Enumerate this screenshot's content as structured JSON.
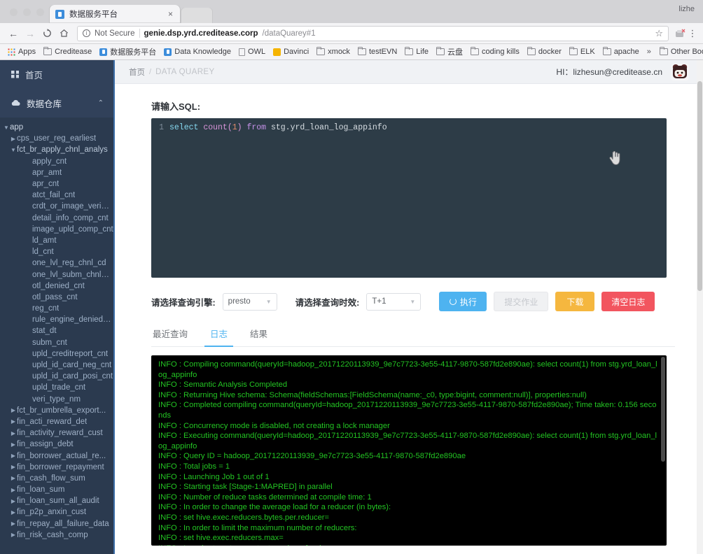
{
  "browser": {
    "tab": {
      "title": "数据服务平台",
      "favicon": "blue-doc-icon",
      "close_label": "×"
    },
    "profile": "lizhe",
    "nav": {
      "back": "←",
      "forward": "→",
      "reload": "C",
      "home": "⌂"
    },
    "omnibox": {
      "security_label": "Not Secure",
      "url_host": "genie.dsp.yrd.creditease.corp",
      "url_path": "/dataQuarey#1",
      "star": "☆",
      "menu": "⋮"
    },
    "bookmarks": [
      {
        "label": "Apps",
        "icon": "apps-grid-icon"
      },
      {
        "label": "Creditease",
        "icon": "folder-icon"
      },
      {
        "label": "数据服务平台",
        "icon": "blue-doc-icon"
      },
      {
        "label": "Data Knowledge",
        "icon": "blue-doc-icon"
      },
      {
        "label": "OWL",
        "icon": "page-icon"
      },
      {
        "label": "Davinci",
        "icon": "yellow-doc-icon"
      },
      {
        "label": "xmock",
        "icon": "folder-icon"
      },
      {
        "label": "testEVN",
        "icon": "folder-icon"
      },
      {
        "label": "Life",
        "icon": "folder-icon"
      },
      {
        "label": "云盘",
        "icon": "folder-icon"
      },
      {
        "label": "coding kills",
        "icon": "folder-icon"
      },
      {
        "label": "docker",
        "icon": "folder-icon"
      },
      {
        "label": "ELK",
        "icon": "folder-icon"
      },
      {
        "label": "apache",
        "icon": "folder-icon"
      }
    ],
    "bookmarks_overflow": "»",
    "other_bookmarks": "Other Bookmarks"
  },
  "sidebar": {
    "home_label": "首页",
    "group_label": "数据仓库",
    "group_caret": "⌃",
    "tree": [
      {
        "level": 0,
        "arrow": "▼",
        "label": "app"
      },
      {
        "level": 1,
        "arrow": "▶",
        "label": "cps_user_reg_earliest"
      },
      {
        "level": 1,
        "arrow": "▼",
        "label": "fct_br_apply_chnl_analys"
      },
      {
        "level": 2,
        "arrow": "",
        "label": "apply_cnt"
      },
      {
        "level": 2,
        "arrow": "",
        "label": "apr_amt"
      },
      {
        "level": 2,
        "arrow": "",
        "label": "apr_cnt"
      },
      {
        "level": 2,
        "arrow": "",
        "label": "atct_fail_cnt"
      },
      {
        "level": 2,
        "arrow": "",
        "label": "crdt_or_image_veri_cnt"
      },
      {
        "level": 2,
        "arrow": "",
        "label": "detail_info_comp_cnt"
      },
      {
        "level": 2,
        "arrow": "",
        "label": "image_upld_comp_cnt"
      },
      {
        "level": 2,
        "arrow": "",
        "label": "ld_amt"
      },
      {
        "level": 2,
        "arrow": "",
        "label": "ld_cnt"
      },
      {
        "level": 2,
        "arrow": "",
        "label": "one_lvl_reg_chnl_cd"
      },
      {
        "level": 2,
        "arrow": "",
        "label": "one_lvl_subm_chnl_cd"
      },
      {
        "level": 2,
        "arrow": "",
        "label": "otl_denied_cnt"
      },
      {
        "level": 2,
        "arrow": "",
        "label": "otl_pass_cnt"
      },
      {
        "level": 2,
        "arrow": "",
        "label": "reg_cnt"
      },
      {
        "level": 2,
        "arrow": "",
        "label": "rule_engine_denied_cnt"
      },
      {
        "level": 2,
        "arrow": "",
        "label": "stat_dt"
      },
      {
        "level": 2,
        "arrow": "",
        "label": "subm_cnt"
      },
      {
        "level": 2,
        "arrow": "",
        "label": "upld_creditreport_cnt"
      },
      {
        "level": 2,
        "arrow": "",
        "label": "upld_id_card_neg_cnt"
      },
      {
        "level": 2,
        "arrow": "",
        "label": "upld_id_card_posi_cnt"
      },
      {
        "level": 2,
        "arrow": "",
        "label": "upld_trade_cnt"
      },
      {
        "level": 2,
        "arrow": "",
        "label": "veri_type_nm"
      },
      {
        "level": 1,
        "arrow": "▶",
        "label": "fct_br_umbrella_export..."
      },
      {
        "level": 1,
        "arrow": "▶",
        "label": "fin_acti_reward_det"
      },
      {
        "level": 1,
        "arrow": "▶",
        "label": "fin_activity_reward_cust"
      },
      {
        "level": 1,
        "arrow": "▶",
        "label": "fin_assign_debt"
      },
      {
        "level": 1,
        "arrow": "▶",
        "label": "fin_borrower_actual_re..."
      },
      {
        "level": 1,
        "arrow": "▶",
        "label": "fin_borrower_repayment"
      },
      {
        "level": 1,
        "arrow": "▶",
        "label": "fin_cash_flow_sum"
      },
      {
        "level": 1,
        "arrow": "▶",
        "label": "fin_loan_sum"
      },
      {
        "level": 1,
        "arrow": "▶",
        "label": "fin_loan_sum_all_audit"
      },
      {
        "level": 1,
        "arrow": "▶",
        "label": "fin_p2p_anxin_cust"
      },
      {
        "level": 1,
        "arrow": "▶",
        "label": "fin_repay_all_failure_data"
      },
      {
        "level": 1,
        "arrow": "▶",
        "label": "fin_risk_cash_comp"
      }
    ]
  },
  "header": {
    "breadcrumb_home": "首页",
    "breadcrumb_sep": "/",
    "breadcrumb_current": "DATA QUAREY",
    "greeting": "HI：lizhesun@creditease.cn",
    "avatar": "panda-avatar"
  },
  "editor": {
    "label": "请输入SQL:",
    "line_number": "1",
    "tokens": {
      "select": "select ",
      "count": "count(",
      "one": "1",
      "paren": ") ",
      "from": "from ",
      "table": "stg.yrd_loan_log_appinfo"
    },
    "full_sql": "select count(1) from stg.yrd_loan_log_appinfo"
  },
  "controls": {
    "engine_label": "请选择查询引擎:",
    "engine_value": "presto",
    "engine_caret": "▼",
    "timeliness_label": "请选择查询时效:",
    "timeliness_value": "T+1",
    "timeliness_caret": "▼",
    "run_button": "执行",
    "submit_button": "提交作业",
    "download_button": "下载",
    "clear_button": "清空日志"
  },
  "tabs": [
    {
      "label": "最近查询",
      "active": false
    },
    {
      "label": "日志",
      "active": true
    },
    {
      "label": "结果",
      "active": false
    }
  ],
  "console": {
    "lines": [
      "INFO : Compiling command(queryId=hadoop_20171220113939_9e7c7723-3e55-4117-9870-587fd2e890ae): select count(1) from stg.yrd_loan_log_appinfo",
      "INFO : Semantic Analysis Completed",
      "INFO : Returning Hive schema: Schema(fieldSchemas:[FieldSchema(name:_c0, type:bigint, comment:null)], properties:null)",
      "INFO : Completed compiling command(queryId=hadoop_20171220113939_9e7c7723-3e55-4117-9870-587fd2e890ae); Time taken: 0.156 seconds",
      "INFO : Concurrency mode is disabled, not creating a lock manager",
      "INFO : Executing command(queryId=hadoop_20171220113939_9e7c7723-3e55-4117-9870-587fd2e890ae): select count(1) from stg.yrd_loan_log_appinfo",
      "INFO : Query ID = hadoop_20171220113939_9e7c7723-3e55-4117-9870-587fd2e890ae",
      "INFO : Total jobs = 1",
      "INFO : Launching Job 1 out of 1",
      "INFO : Starting task [Stage-1:MAPRED] in parallel",
      "INFO : Number of reduce tasks determined at compile time: 1",
      "INFO : In order to change the average load for a reducer (in bytes):",
      "INFO : set hive.exec.reducers.bytes.per.reducer=",
      "INFO : In order to limit the maximum number of reducers:",
      "INFO : set hive.exec.reducers.max=",
      "INFO : In order to set a constant number of reducers:"
    ]
  },
  "colors": {
    "sidebar_bg": "#2b3a4f",
    "accent_blue": "#4eb3f0",
    "download_orange": "#f5b73f",
    "clear_red": "#f2555f",
    "editor_bg": "#2d3c47",
    "console_green": "#23c423",
    "console_bg": "#000000"
  }
}
